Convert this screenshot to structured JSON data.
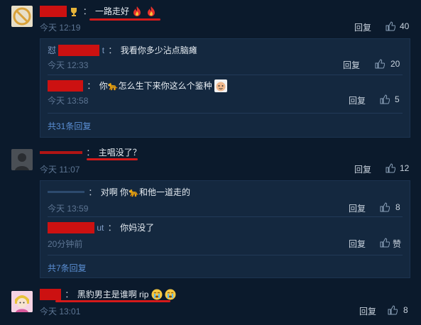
{
  "comments": [
    {
      "text": "一路走好",
      "time": "今天 12:19",
      "reply_label": "回复",
      "likes": "40",
      "replies": [
        {
          "user_prefix": "怼",
          "user_suffix": "t",
          "text": "我看你多少沾点脑瘫",
          "time": "今天 12:33",
          "reply_label": "回复",
          "likes": "20"
        },
        {
          "text": "你🐆怎么生下来你这么个鉴种",
          "time": "今天 13:58",
          "reply_label": "回复",
          "likes": "5"
        }
      ],
      "more_label": "共31条回复"
    },
    {
      "text": "主唱没了？",
      "time": "今天 11:07",
      "reply_label": "回复",
      "likes": "12",
      "replies": [
        {
          "text": "对啊 你🐆和他一道走的",
          "time": "今天 13:59",
          "reply_label": "回复",
          "likes": "8"
        },
        {
          "user_suffix": "ut",
          "text": "你妈没了",
          "time": "20分钟前",
          "reply_label": "回复",
          "likes": "赞"
        }
      ],
      "more_label": "共7条回复"
    },
    {
      "text": "黑豹男主是谁啊 rip",
      "time": "今天 13:01",
      "reply_label": "回复",
      "likes": "8"
    }
  ],
  "colors": {
    "background": "#0b1a2c",
    "reply_box": "#14283f",
    "link": "#5b8fd4",
    "redaction": "#cc1111"
  },
  "icons": [
    "thumbs-up-icon",
    "fire-icon",
    "crying-emoji-icon",
    "trophy-badge-icon"
  ]
}
